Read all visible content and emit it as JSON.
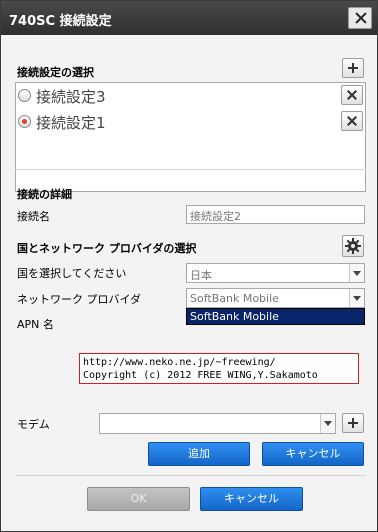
{
  "window": {
    "title": "740SC 接続設定"
  },
  "connection_select": {
    "heading": "接続設定の選択",
    "items": [
      {
        "label": "接続設定3",
        "selected": false
      },
      {
        "label": "接続設定1",
        "selected": true
      }
    ]
  },
  "details": {
    "heading": "接続の詳細",
    "name_label": "接続名",
    "name_value": "接続設定2"
  },
  "provider": {
    "heading": "国とネットワーク プロバイダの選択",
    "country_label": "国を選択してください",
    "country_value": "日本",
    "network_label": "ネットワーク プロバイダ",
    "network_value": "SoftBank Mobile",
    "dropdown_option": "SoftBank Mobile",
    "apn_label": "APN 名"
  },
  "credits": {
    "line1": "http://www.neko.ne.jp/~freewing/",
    "line2": "Copyright (c) 2012 FREE WING,Y.Sakamoto"
  },
  "modem": {
    "label": "モデム",
    "value": ""
  },
  "actions": {
    "add_label": "追加",
    "cancel_label": "キャンセル",
    "ok_label": "OK",
    "dialog_cancel_label": "キャンセル"
  }
}
